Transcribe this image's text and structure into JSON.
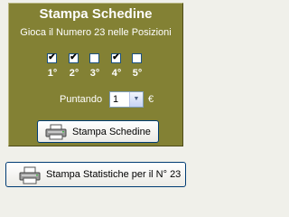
{
  "panel": {
    "title": "Stampa Schedine",
    "subtitle_prefix": "Gioca il Numero",
    "number": "23",
    "subtitle_suffix": "nelle Posizioni",
    "positions": [
      {
        "label": "1°",
        "checked": true
      },
      {
        "label": "2°",
        "checked": true
      },
      {
        "label": "3°",
        "checked": false
      },
      {
        "label": "4°",
        "checked": true
      },
      {
        "label": "5°",
        "checked": false
      }
    ],
    "puntando_label": "Puntando",
    "amount_value": "1",
    "currency": "€",
    "print_button": "Stampa Schedine"
  },
  "stats_button": "Stampa Statistiche per il N° 23",
  "colors": {
    "panel_bg": "#838134",
    "window_bg": "#f0f0ea",
    "text": "#ffffff"
  }
}
